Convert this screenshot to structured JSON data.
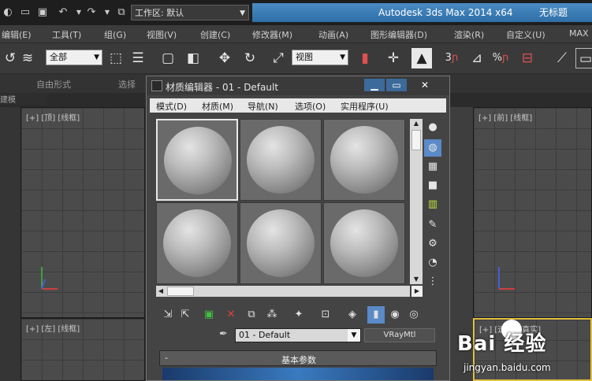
{
  "titlebar": {
    "workspace_label": "工作区: 默认",
    "app_title": "Autodesk 3ds Max  2014 x64",
    "doc_title": "无标题"
  },
  "menu": {
    "items": [
      "编辑(E)",
      "工具(T)",
      "组(G)",
      "视图(V)",
      "创建(C)",
      "修改器(M)",
      "动画(A)",
      "图形编辑器(D)",
      "渲染(R)",
      "自定义(U)",
      "MAX"
    ]
  },
  "toolbar": {
    "selection_filter": "全部",
    "ref_coord": "视图",
    "snap_labels": [
      "3",
      "%"
    ]
  },
  "ribbon": {
    "tabs": [
      "",
      "自由形式",
      "选择"
    ],
    "sub_label": "建模"
  },
  "viewports": {
    "top_left": "[+] [顶] [线框]",
    "top_right": "[+] [前] [线框]",
    "bottom_left": "[+] [左] [线框]",
    "bottom_right": "[+] [透视] [真实]"
  },
  "material_editor": {
    "title": "材质编辑器 - 01 - Default",
    "menu": [
      "模式(D)",
      "材质(M)",
      "导航(N)",
      "选项(O)",
      "实用程序(U)"
    ],
    "material_name": "01 - Default",
    "material_type": "VRayMtl",
    "rollout_title": "基本参数",
    "rollout_toggle": "-"
  },
  "watermark": {
    "brand": "Bai  经验",
    "url": "jingyan.baidu.com"
  },
  "colors": {
    "title_accent": "#3a7cb8",
    "viewport_bg": "#4b4b4b",
    "panel_bg": "#444444"
  }
}
